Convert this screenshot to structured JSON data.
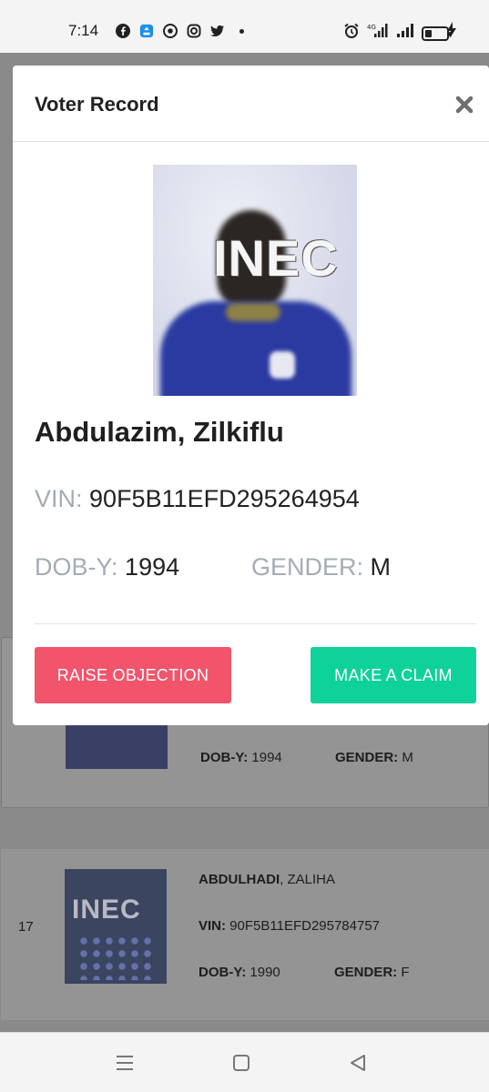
{
  "status_bar": {
    "time": "7:14",
    "left_icons": [
      "facebook-icon",
      "app-store-icon",
      "chrome-icon",
      "instagram-icon",
      "twitter-icon"
    ],
    "right_icons": [
      "alarm-icon",
      "4g-signal-icon",
      "signal-icon",
      "battery-icon",
      "charging-icon"
    ]
  },
  "modal": {
    "title": "Voter Record",
    "photo_watermark": "INEC",
    "name": "Abdulazim, Zilkiflu",
    "vin_label": "VIN:",
    "vin_value": "90F5B11EFD295264954",
    "dob_label": "DOB-Y:",
    "dob_value": "1994",
    "gender_label": "GENDER:",
    "gender_value": "M",
    "raise_objection_label": "RAISE OBJECTION",
    "make_claim_label": "MAKE A CLAIM"
  },
  "background_list": {
    "item1": {
      "dob_label": "DOB-Y:",
      "dob_value": "1994",
      "gender_label": "GENDER:",
      "gender_value": "M"
    },
    "item2": {
      "index": "17",
      "surname": "ABDULHADI",
      "given_name": ", ZALIHA",
      "photo_watermark": "INEC",
      "vin_label": "VIN:",
      "vin_value": "90F5B11EFD295784757",
      "dob_label": "DOB-Y:",
      "dob_value": "1990",
      "gender_label": "GENDER:",
      "gender_value": "F"
    }
  },
  "colors": {
    "objection": "#f2546c",
    "claim": "#0fd29a",
    "label_grey": "#a3acb6"
  }
}
